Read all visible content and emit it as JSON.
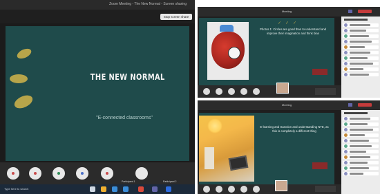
{
  "left": {
    "window_title": "Zoom Meeting - The New Normal - Screen sharing",
    "share_button": "Stop screen share",
    "slide_title": "THE NEW NORMAL",
    "slide_subtitle": "\"E-connected classrooms\"",
    "controls": [
      {
        "icon": "mic-icon",
        "color": "#e8e8e8"
      },
      {
        "icon": "video-icon",
        "color": "#e8e8e8"
      },
      {
        "icon": "participants-icon",
        "color": "#e8e8e8"
      },
      {
        "icon": "share-icon",
        "color": "#e8e8e8"
      },
      {
        "icon": "end-call-icon",
        "color": "#e8e8e8"
      },
      {
        "icon": "settings-icon",
        "color": "#e8e8e8"
      }
    ],
    "control_labels": [
      "Participant 1",
      "Participant 2"
    ],
    "status_text": "Type here to search"
  },
  "top_right": {
    "window_title": "Meeting",
    "slide_text": "Photos 1: Circles are good than to understand and improve their imagination and think bias",
    "ticks": "✓✓✓"
  },
  "bottom_right": {
    "window_title": "Meeting",
    "slide_text": "E-learning and Sanction and understanding NTE, as this is completely a different thing"
  },
  "colors": {
    "slide_bg": "#1f4b4b",
    "accent_gold": "#b7a54a",
    "accent_red": "#8a2a2a",
    "teams_purple": "#6264a7"
  }
}
